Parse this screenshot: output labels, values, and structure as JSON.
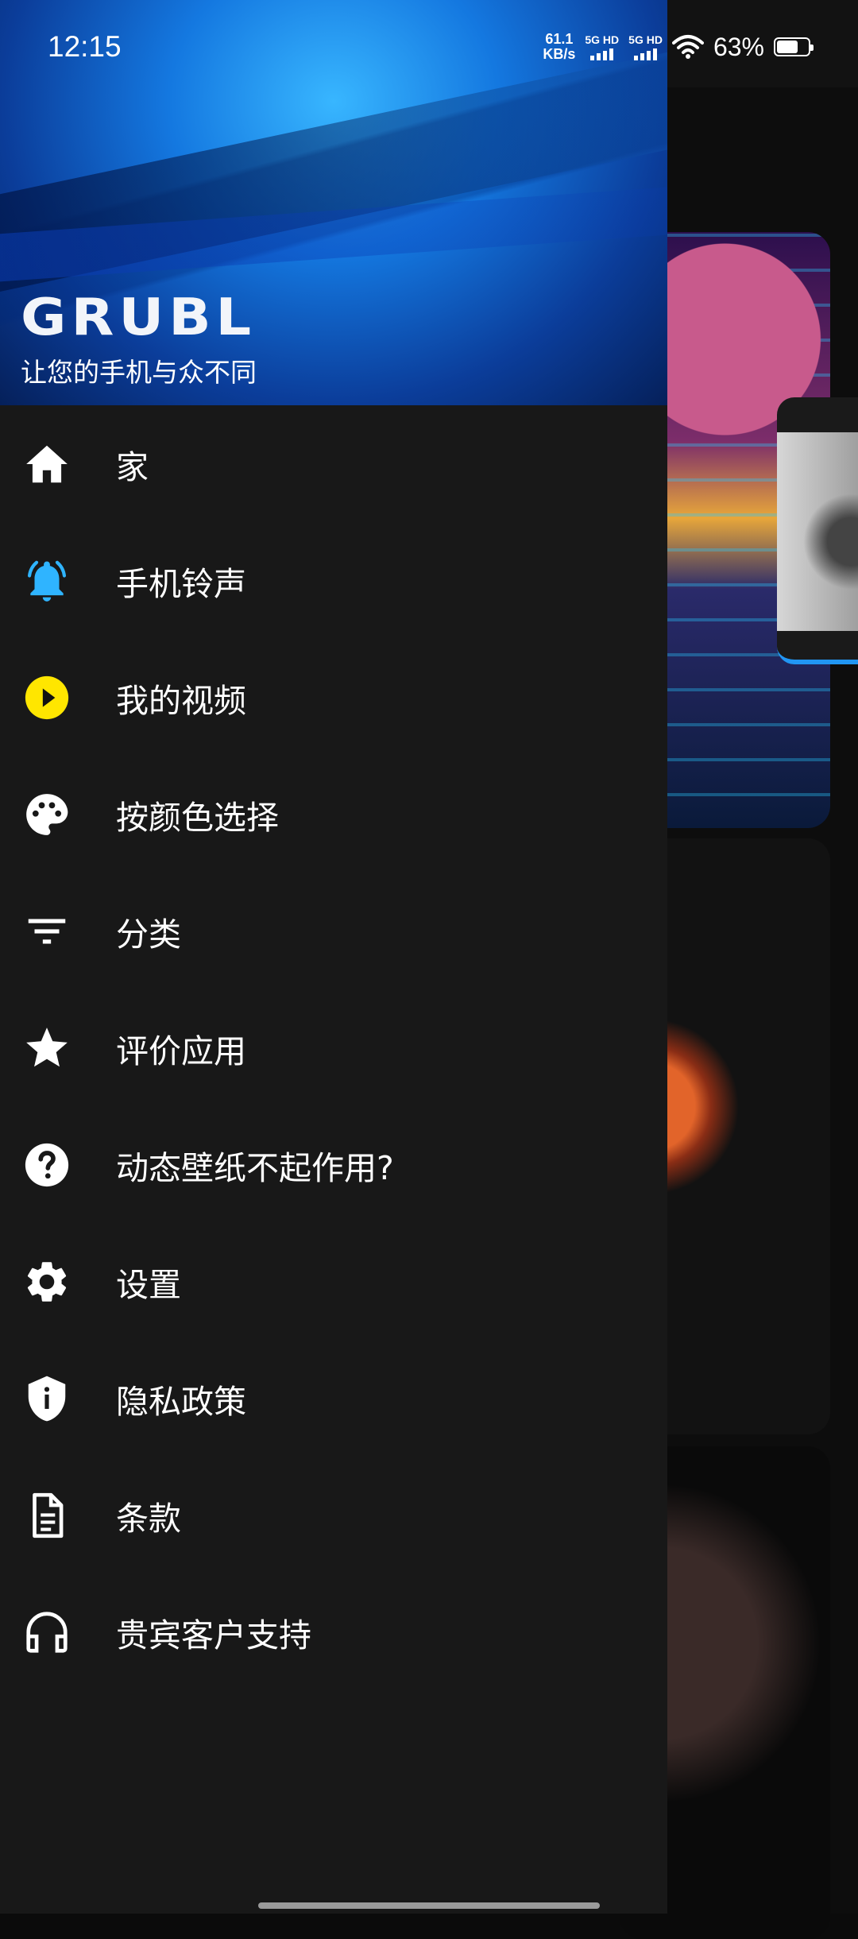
{
  "status_bar": {
    "time": "12:15",
    "speed_value": "61.1",
    "speed_unit": "KB/s",
    "sim1": "5G HD",
    "sim2": "5G HD",
    "battery": "63%"
  },
  "drawer": {
    "logo": "GRUBL",
    "tagline": "让您的手机与众不同",
    "items": [
      {
        "label": "家",
        "icon": "home-icon",
        "color": "#ffffff"
      },
      {
        "label": "手机铃声",
        "icon": "bell-icon",
        "color": "#2fb4ff"
      },
      {
        "label": "我的视频",
        "icon": "play-circle-icon",
        "color": "#ffe600"
      },
      {
        "label": "按颜色选择",
        "icon": "palette-icon",
        "color": "#ffffff"
      },
      {
        "label": "分类",
        "icon": "filter-icon",
        "color": "#ffffff"
      },
      {
        "label": "评价应用",
        "icon": "star-icon",
        "color": "#ffffff"
      },
      {
        "label": "动态壁纸不起作用?",
        "icon": "help-icon",
        "color": "#ffffff"
      },
      {
        "label": "设置",
        "icon": "gear-icon",
        "color": "#ffffff"
      },
      {
        "label": "隐私政策",
        "icon": "shield-icon",
        "color": "#ffffff"
      },
      {
        "label": "条款",
        "icon": "document-icon",
        "color": "#ffffff"
      },
      {
        "label": "贵宾客户支持",
        "icon": "headphones-icon",
        "color": "#ffffff"
      }
    ]
  }
}
